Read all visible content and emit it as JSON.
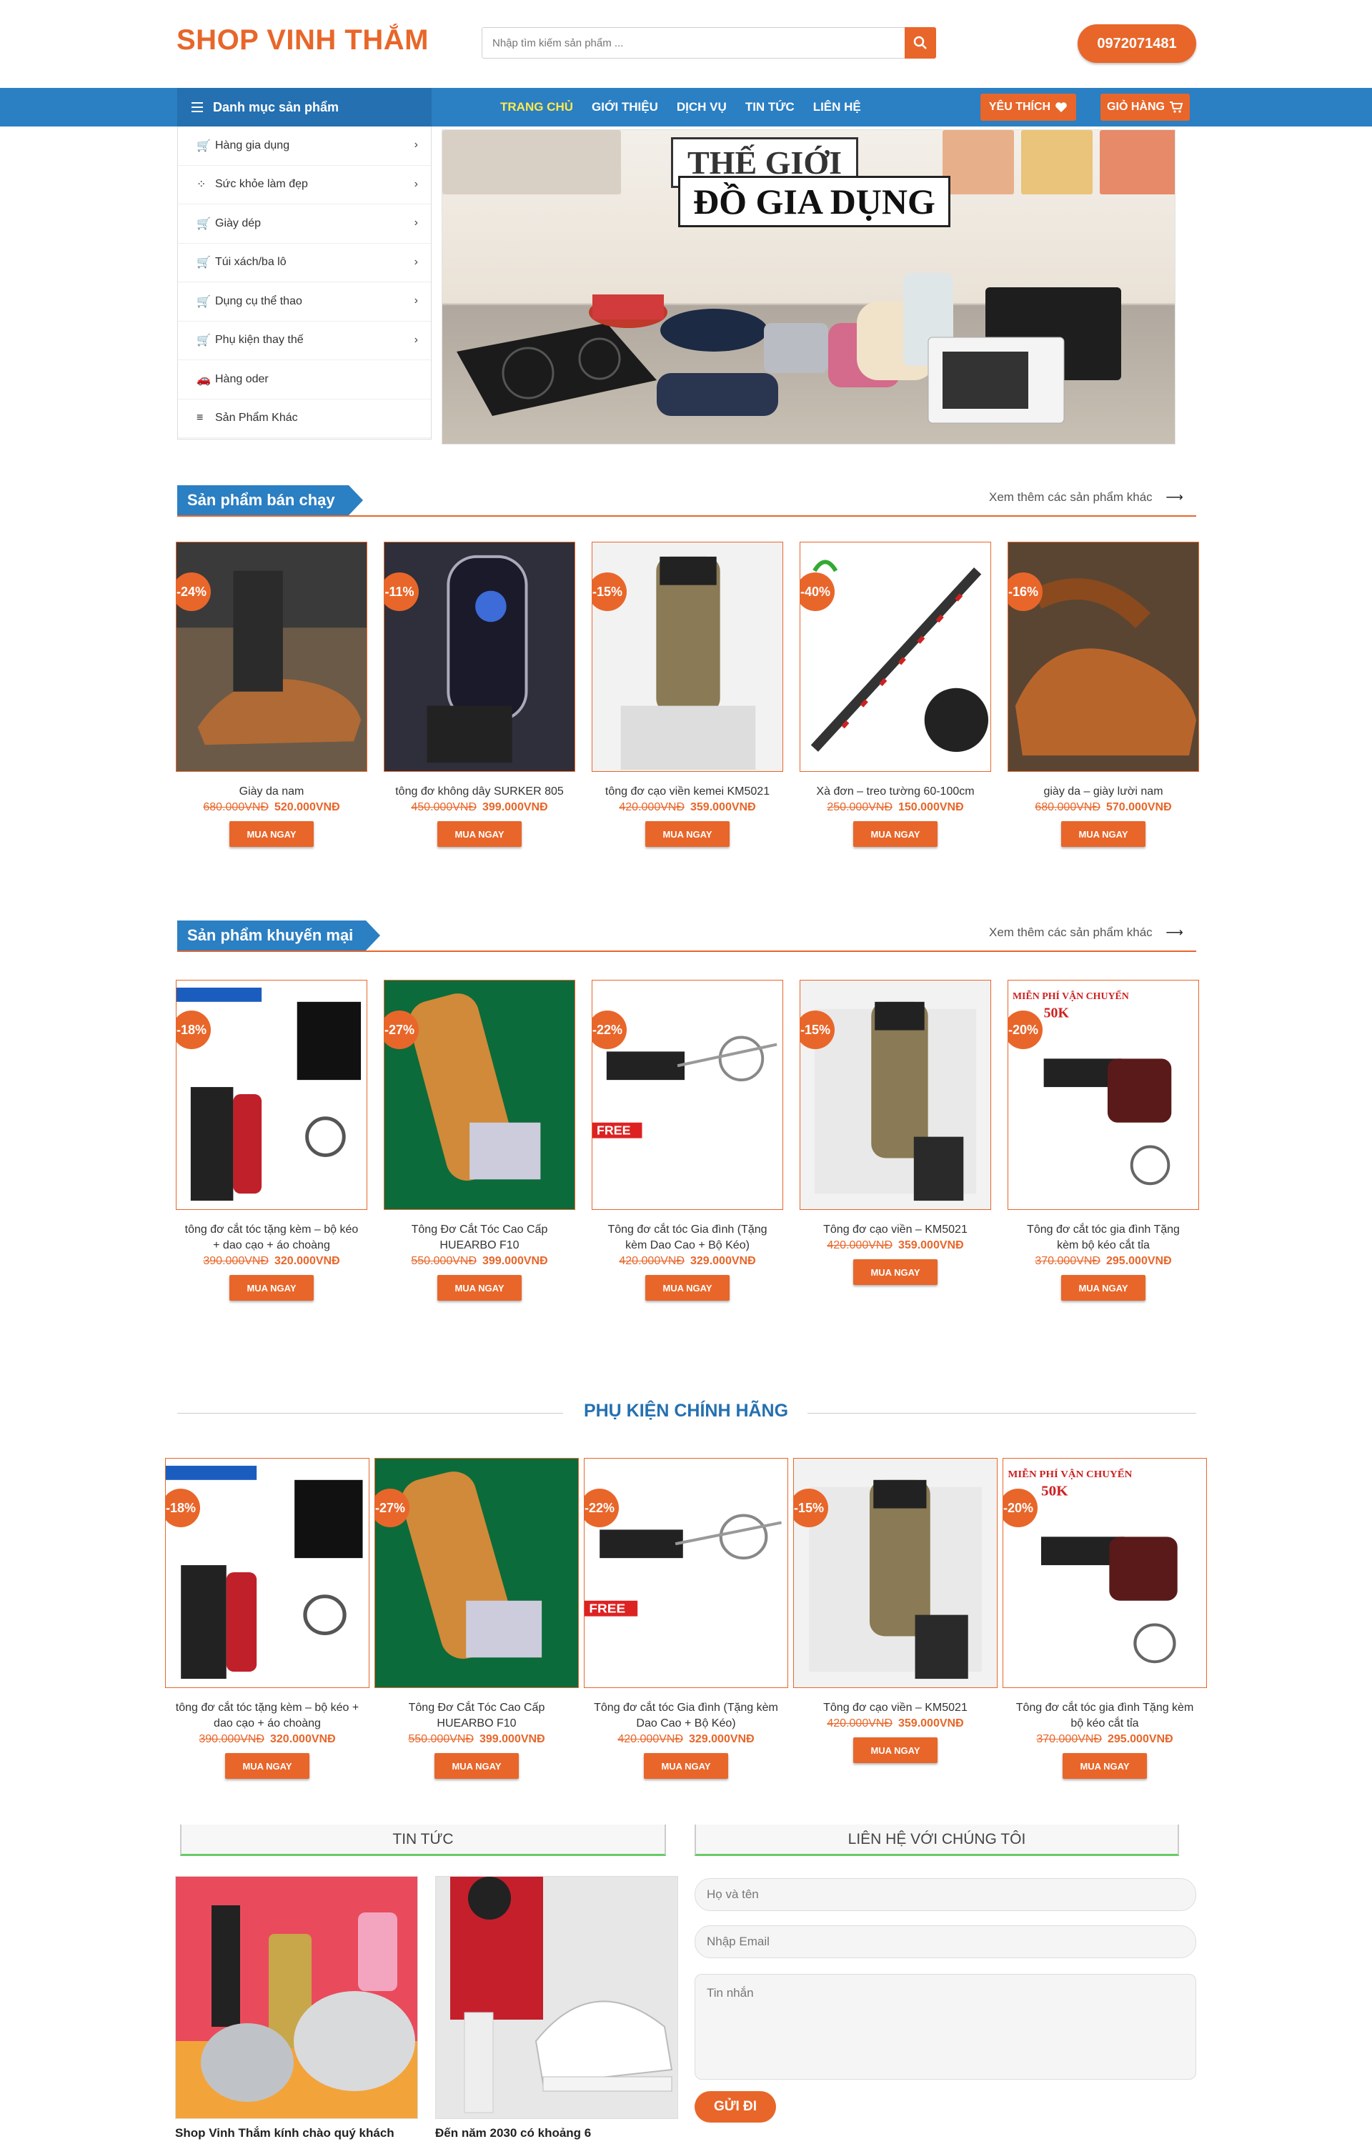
{
  "header": {
    "logo": "SHOP VINH THẮM",
    "search_placeholder": "Nhập tìm kiếm sản phẩm ...",
    "phone": "0972071481"
  },
  "nav": {
    "category_label": "Danh mục sản phẩm",
    "menu": [
      "TRANG CHỦ",
      "GIỚI THIỆU",
      "DỊCH VỤ",
      "TIN TỨC",
      "LIÊN HỆ"
    ],
    "wishlist": "YÊU THÍCH",
    "cart": "GIỎ HÀNG"
  },
  "categories": [
    {
      "label": "Hàng gia dụng",
      "icon": "cart-icon",
      "arrow": true
    },
    {
      "label": "Sức khỏe làm đẹp",
      "icon": "dots-icon",
      "arrow": true
    },
    {
      "label": "Giày dép",
      "icon": "cart-icon",
      "arrow": true
    },
    {
      "label": "Túi xách/ba lô",
      "icon": "cart-icon",
      "arrow": true
    },
    {
      "label": "Dụng cụ thể thao",
      "icon": "cart-icon",
      "arrow": true
    },
    {
      "label": "Phụ kiện thay thế",
      "icon": "cart-icon",
      "arrow": true
    },
    {
      "label": "Hàng oder",
      "icon": "car-icon",
      "arrow": false
    },
    {
      "label": "Sản Phẩm Khác",
      "icon": "list-icon",
      "arrow": false
    }
  ],
  "banner": {
    "line1": "THẾ GIỚI",
    "line2": "ĐỒ GIA DỤNG"
  },
  "bestseller": {
    "title": "Sản phẩm bán chạy",
    "more": "Xem thêm các sản phẩm khác",
    "items": [
      {
        "name": "Giày da nam",
        "old": "680.000VNĐ",
        "new": "520.000VNĐ",
        "badge": "-24%",
        "art": "shoe"
      },
      {
        "name": "tông đơ không dây SURKER 805",
        "old": "450.000VNĐ",
        "new": "399.000VNĐ",
        "badge": "-11%",
        "art": "clipper"
      },
      {
        "name": "tông đơ cạo viền kemei KM5021",
        "old": "420.000VNĐ",
        "new": "359.000VNĐ",
        "badge": "-15%",
        "art": "trimmer"
      },
      {
        "name": "Xà đơn – treo tường 60-100cm",
        "old": "250.000VNĐ",
        "new": "150.000VNĐ",
        "badge": "-40%",
        "art": "bar"
      },
      {
        "name": "giày da – giày lười nam",
        "old": "680.000VNĐ",
        "new": "570.000VNĐ",
        "badge": "-16%",
        "art": "shoe2"
      }
    ]
  },
  "promo": {
    "title": "Sản phẩm khuyến mại",
    "more": "Xem thêm các sản phẩm khác",
    "items": [
      {
        "name": "tông đơ cắt tóc tặng kèm – bộ kéo + dao cạo + áo choàng",
        "old": "390.000VNĐ",
        "new": "320.000VNĐ",
        "badge": "-18%",
        "art": "kit"
      },
      {
        "name": "Tông Đơ Cắt Tóc Cao Cấp HUEARBO F10",
        "old": "550.000VNĐ",
        "new": "399.000VNĐ",
        "badge": "-27%",
        "art": "gold"
      },
      {
        "name": "Tông đơ cắt tóc Gia đình (Tặng kèm Dao Cao + Bộ Kéo)",
        "old": "420.000VNĐ",
        "new": "329.000VNĐ",
        "badge": "-22%",
        "art": "free"
      },
      {
        "name": "Tông đơ cạo viền – KM5021",
        "old": "420.000VNĐ",
        "new": "359.000VNĐ",
        "badge": "-15%",
        "art": "trimmer2"
      },
      {
        "name": "Tông đơ cắt tóc gia đình Tặng kèm bộ kéo cắt tỉa",
        "old": "370.000VNĐ",
        "new": "295.000VNĐ",
        "badge": "-20%",
        "art": "ship"
      }
    ]
  },
  "accessories": {
    "title": "PHỤ KIỆN CHÍNH HÃNG",
    "items": [
      {
        "name": "tông đơ cắt tóc tặng kèm – bộ kéo + dao cạo + áo choàng",
        "old": "390.000VNĐ",
        "new": "320.000VNĐ",
        "badge": "-18%",
        "art": "kit"
      },
      {
        "name": "Tông Đơ Cắt Tóc Cao Cấp HUEARBO F10",
        "old": "550.000VNĐ",
        "new": "399.000VNĐ",
        "badge": "-27%",
        "art": "gold"
      },
      {
        "name": "Tông đơ cắt tóc Gia đình (Tặng kèm Dao Cao + Bộ Kéo)",
        "old": "420.000VNĐ",
        "new": "329.000VNĐ",
        "badge": "-22%",
        "art": "free"
      },
      {
        "name": "Tông đơ cạo viền – KM5021",
        "old": "420.000VNĐ",
        "new": "359.000VNĐ",
        "badge": "-15%",
        "art": "trimmer2"
      },
      {
        "name": "Tông đơ cắt tóc gia đình Tặng kèm bộ kéo cắt tỉa",
        "old": "370.000VNĐ",
        "new": "295.000VNĐ",
        "badge": "-20%",
        "art": "ship"
      }
    ]
  },
  "buy_label": "MUA NGAY",
  "news": {
    "title": "TIN TỨC",
    "items": [
      {
        "caption": "Shop Vinh Thắm kính chào quý khách"
      },
      {
        "caption": "Đến năm 2030 có khoảng 6"
      }
    ]
  },
  "contact": {
    "title": "LIÊN HỆ VỚI CHÚNG TÔI",
    "name_placeholder": "Họ và tên",
    "email_placeholder": "Nhập Email",
    "message_placeholder": "Tin nhắn",
    "submit": "GỬI ĐI"
  },
  "colors": {
    "accent": "#e8662a",
    "nav": "#2b7fc3",
    "nav_dark": "#2570b0"
  }
}
